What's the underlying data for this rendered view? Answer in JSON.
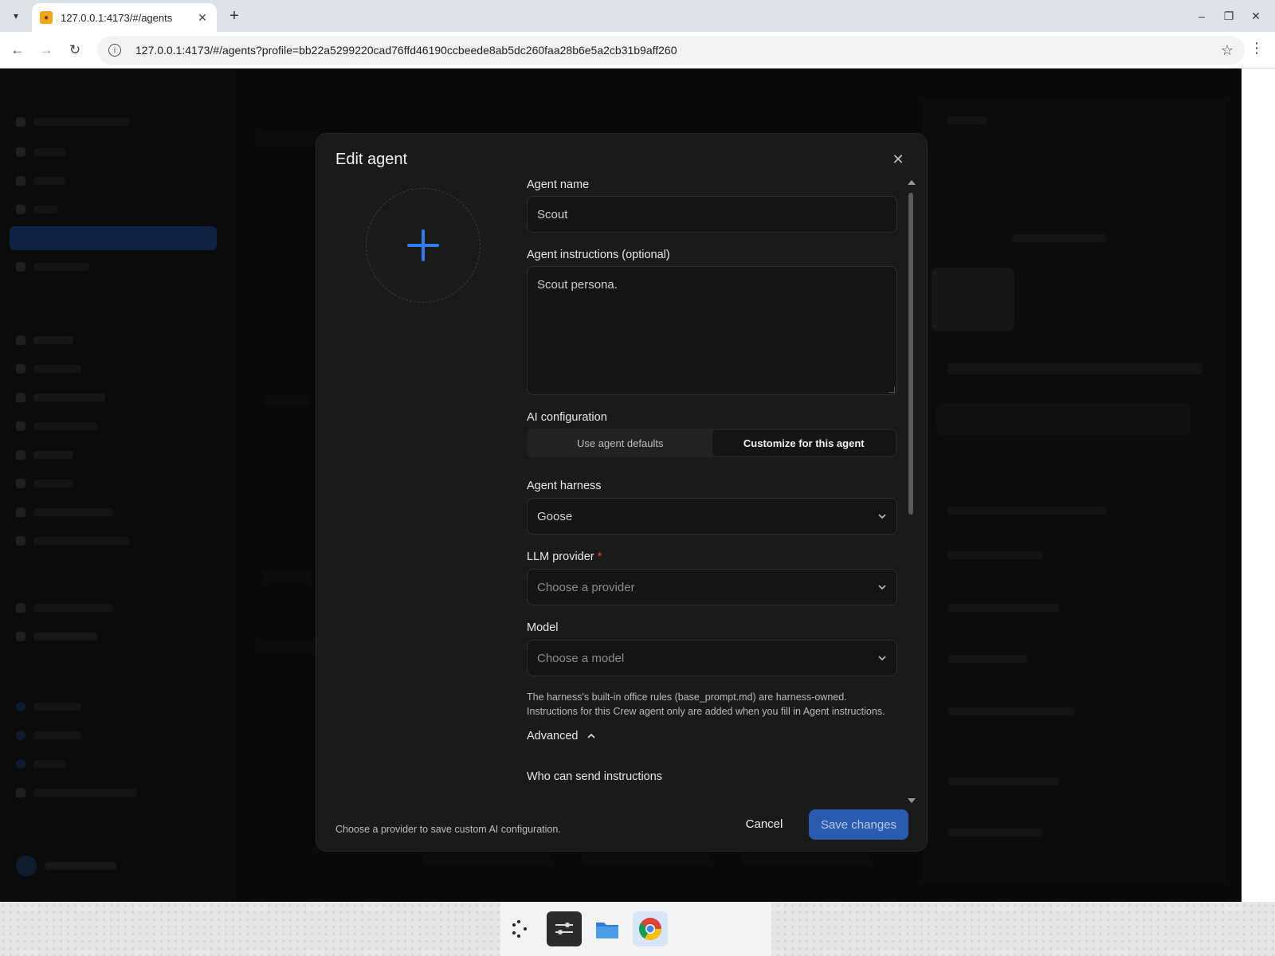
{
  "browser": {
    "tab_title": "127.0.0.1:4173/#/agents",
    "url": "127.0.0.1:4173/#/agents?profile=bb22a5299220cad76ffd46190ccbeede8ab5dc260faa28b6e5a2cb31b9aff260"
  },
  "modal": {
    "title": "Edit agent",
    "agent_name_label": "Agent name",
    "agent_name_value": "Scout",
    "instructions_label": "Agent instructions (optional)",
    "instructions_value": "Scout persona.",
    "ai_config_label": "AI configuration",
    "ai_config_options": [
      "Use agent defaults",
      "Customize for this agent"
    ],
    "ai_config_selected": "Customize for this agent",
    "harness_label": "Agent harness",
    "harness_value": "Goose",
    "provider_label": "LLM provider",
    "provider_required_mark": "*",
    "provider_placeholder": "Choose a provider",
    "model_label": "Model",
    "model_placeholder": "Choose a model",
    "help_line1": "The harness's built-in office rules (base_prompt.md) are harness-owned.",
    "help_line2": "Instructions for this Crew agent only are added when you fill in Agent instructions.",
    "advanced_label": "Advanced",
    "who_can_send_label": "Who can send instructions",
    "footer_note": "Choose a provider to save custom AI configuration.",
    "cancel_label": "Cancel",
    "save_label": "Save changes"
  },
  "icons": [
    "chevron-down-icon",
    "chevron-up-icon",
    "close-icon",
    "plus-icon",
    "back-arrow-icon",
    "forward-arrow-icon",
    "reload-icon",
    "star-icon",
    "site-info-icon"
  ],
  "colors": {
    "accent": "#2f7df6",
    "save_button": "#2b5bb0",
    "required": "#ef4444",
    "modal_bg": "#1a1a1a"
  }
}
